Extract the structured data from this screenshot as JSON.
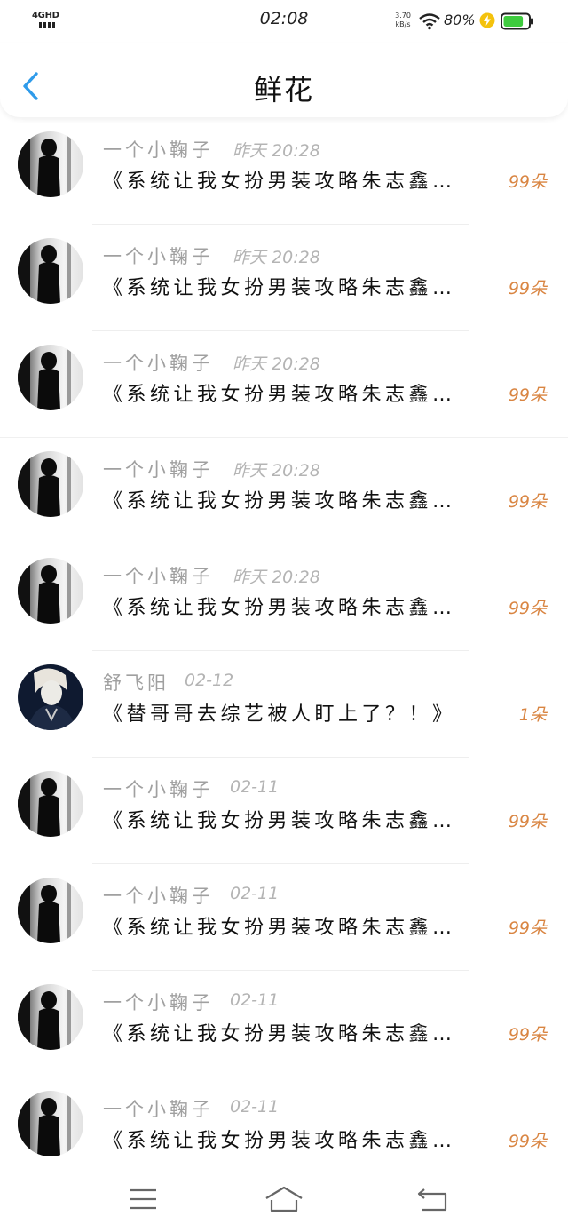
{
  "status_bar": {
    "network": "4GHD",
    "time": "02:08",
    "speed_value": "3.70",
    "speed_unit": "kB/s",
    "battery_percent": "80%",
    "battery_level": 0.8
  },
  "header": {
    "title": "鲜花",
    "back_icon": "chevron-left-icon"
  },
  "colors": {
    "accent": "#2f9bea",
    "flowers": "#d98542",
    "username": "#a0a0a0",
    "battery": "#3ecb3e",
    "charge": "#f4c20d"
  },
  "list": [
    {
      "user": "一个小鞠子",
      "time": "昨天 20:28",
      "title": "《系统让我女扮男装攻略朱志鑫…",
      "flowers": "99朵",
      "avatar": "silhouette"
    },
    {
      "user": "一个小鞠子",
      "time": "昨天 20:28",
      "title": "《系统让我女扮男装攻略朱志鑫…",
      "flowers": "99朵",
      "avatar": "silhouette"
    },
    {
      "user": "一个小鞠子",
      "time": "昨天 20:28",
      "title": "《系统让我女扮男装攻略朱志鑫…",
      "flowers": "99朵",
      "avatar": "silhouette"
    },
    {
      "user": "一个小鞠子",
      "time": "昨天 20:28",
      "title": "《系统让我女扮男装攻略朱志鑫…",
      "flowers": "99朵",
      "avatar": "silhouette"
    },
    {
      "user": "一个小鞠子",
      "time": "昨天 20:28",
      "title": "《系统让我女扮男装攻略朱志鑫…",
      "flowers": "99朵",
      "avatar": "silhouette"
    },
    {
      "user": "舒飞阳",
      "time": "02-12",
      "title": "《替哥哥去综艺被人盯上了？！》",
      "flowers": "1朵",
      "avatar": "portrait"
    },
    {
      "user": "一个小鞠子",
      "time": "02-11",
      "title": "《系统让我女扮男装攻略朱志鑫…",
      "flowers": "99朵",
      "avatar": "silhouette"
    },
    {
      "user": "一个小鞠子",
      "time": "02-11",
      "title": "《系统让我女扮男装攻略朱志鑫…",
      "flowers": "99朵",
      "avatar": "silhouette"
    },
    {
      "user": "一个小鞠子",
      "time": "02-11",
      "title": "《系统让我女扮男装攻略朱志鑫…",
      "flowers": "99朵",
      "avatar": "silhouette"
    },
    {
      "user": "一个小鞠子",
      "time": "02-11",
      "title": "《系统让我女扮男装攻略朱志鑫…",
      "flowers": "99朵",
      "avatar": "silhouette"
    }
  ],
  "nav_bar": {
    "menu_icon": "menu-icon",
    "home_icon": "home-icon",
    "back_icon": "back-arrow-icon"
  }
}
